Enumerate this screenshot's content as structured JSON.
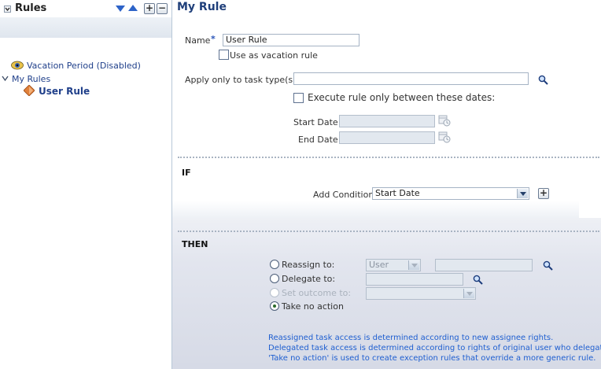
{
  "navigator": {
    "title": "Rules",
    "tree": [
      {
        "label": "Vacation Period (Disabled)"
      },
      {
        "label": "My Rules"
      },
      {
        "label": "User Rule"
      }
    ]
  },
  "rule": {
    "title": "My Rule",
    "name_label": "Name",
    "required_marker": "*",
    "name_value": "User Rule",
    "vacation_label": "Use as vacation rule",
    "task_types_label": "Apply only to task type(s)",
    "task_types_value": "",
    "dates_label": "Execute rule only between these dates:",
    "start_date_label": "Start Date",
    "end_date_label": "End Date"
  },
  "if_section": {
    "heading": "IF",
    "add_condition_label": "Add Condition",
    "condition_value": "Start Date"
  },
  "then_section": {
    "heading": "THEN",
    "options": [
      {
        "label": "Reassign to:"
      },
      {
        "label": "Delegate to:"
      },
      {
        "label": "Set outcome to:"
      },
      {
        "label": "Take no action"
      }
    ],
    "reassign_type_value": "User",
    "notes": [
      "Reassigned task access is determined according to new assignee rights.",
      "Delegated task access is determined according to rights of original user who delegates.",
      "'Take no action' is used to create exception rules that override a more generic rule."
    ]
  },
  "colors": {
    "title_blue": "#1f3f7a",
    "link_blue": "#1f5fd0",
    "then_band": "#d6dae6"
  }
}
